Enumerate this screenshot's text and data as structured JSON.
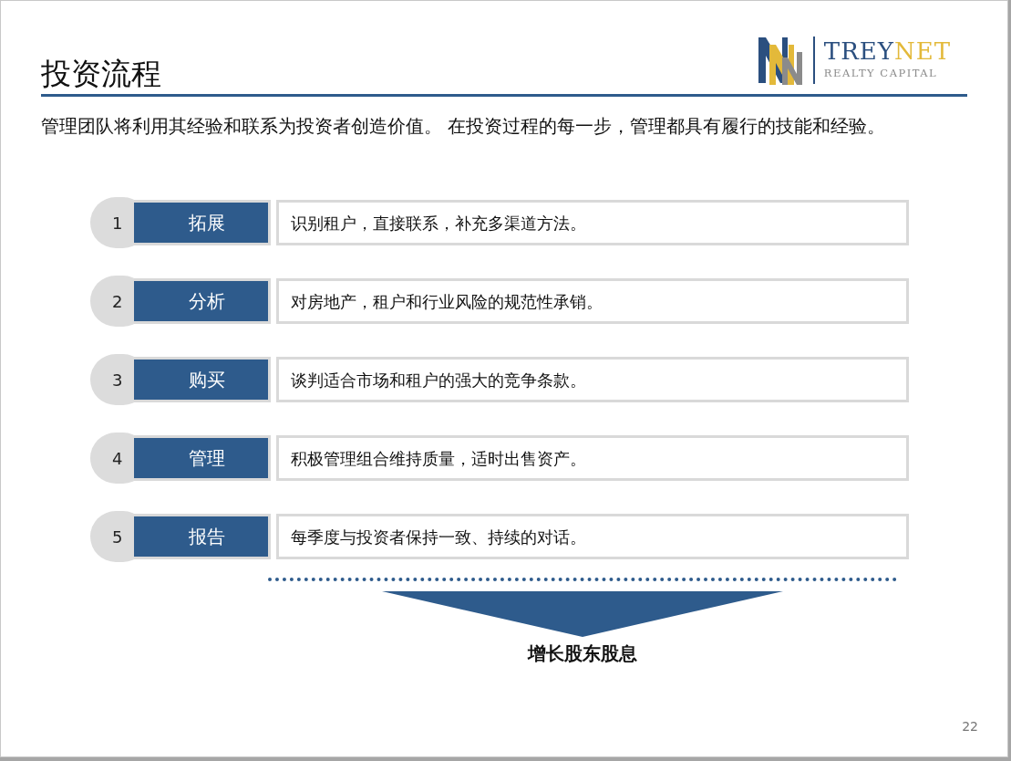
{
  "slide": {
    "title": "投资流程",
    "logo": {
      "name_first": "TREY",
      "name_second": "NET",
      "subtitle": "REALTY CAPITAL"
    },
    "intro": "管理团队将利用其经验和联系为投资者创造价值。 在投资过程的每一步，管理都具有履行的技能和经验。",
    "steps": [
      {
        "number": "1",
        "label": "拓展",
        "description": "识别租户，直接联系，补充多渠道方法。"
      },
      {
        "number": "2",
        "label": "分析",
        "description": "对房地产，租户和行业风险的规范性承销。"
      },
      {
        "number": "3",
        "label": "购买",
        "description": "谈判适合市场和租户的强大的竞争条款。"
      },
      {
        "number": "4",
        "label": "管理",
        "description": "积极管理组合维持质量，适时出售资产。"
      },
      {
        "number": "5",
        "label": "报告",
        "description": "每季度与投资者保持一致、持续的对话。"
      }
    ],
    "result": "增长股东股息",
    "page_number": "22"
  }
}
